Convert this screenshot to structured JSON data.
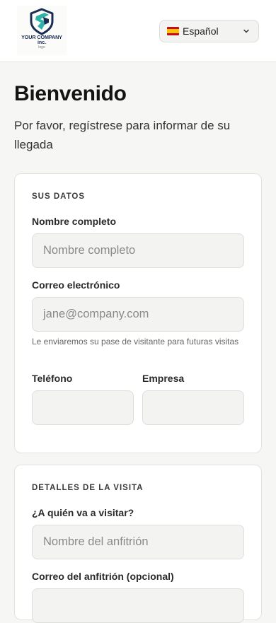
{
  "header": {
    "logo": {
      "company_line": "YOUR COMPANY",
      "suffix_line": "inc.",
      "tag_line": "logo",
      "colors": {
        "teal": "#2bb3a8",
        "navy": "#1b2c54"
      }
    },
    "language": {
      "selected": "Español",
      "flag": "es-flag-icon"
    }
  },
  "page": {
    "title": "Bienvenido",
    "subtitle": "Por favor, regístrese para informar de su llegada"
  },
  "your_data": {
    "section_title": "SUS DATOS",
    "full_name": {
      "label": "Nombre completo",
      "placeholder": "Nombre completo",
      "value": ""
    },
    "email": {
      "label": "Correo electrónico",
      "placeholder": "jane@company.com",
      "value": "",
      "hint": "Le enviaremos su pase de visitante para futuras visitas"
    },
    "phone": {
      "label": "Teléfono",
      "placeholder": "",
      "value": ""
    },
    "company": {
      "label": "Empresa",
      "placeholder": "",
      "value": ""
    }
  },
  "visit_details": {
    "section_title": "DETALLES DE LA VISITA",
    "host": {
      "label": "¿A quién va a visitar?",
      "placeholder": "Nombre del anfitrión",
      "value": ""
    },
    "host_email": {
      "label": "Correo del anfitrión (opcional)",
      "placeholder": "",
      "value": ""
    }
  }
}
